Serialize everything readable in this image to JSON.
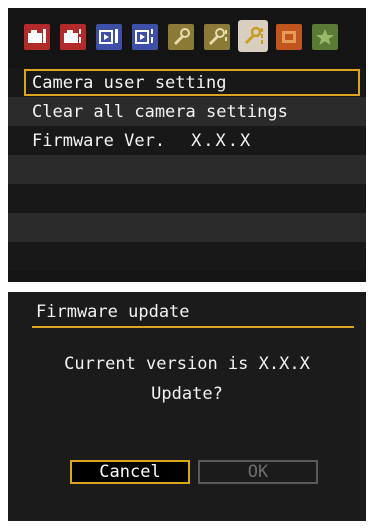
{
  "tabs": [
    {
      "name": "shooting-menu-1",
      "icon": "camera-icon",
      "color": "#b32a2a",
      "selected": false
    },
    {
      "name": "shooting-menu-2",
      "icon": "camera-dots-icon",
      "color": "#b32a2a",
      "selected": false
    },
    {
      "name": "playback-menu-1",
      "icon": "playback-icon",
      "color": "#3e4fa8",
      "selected": false
    },
    {
      "name": "playback-menu-2",
      "icon": "playback-dots-icon",
      "color": "#3e4fa8",
      "selected": false
    },
    {
      "name": "setup-menu-1",
      "icon": "wrench-icon",
      "color": "#8a7a35",
      "selected": false
    },
    {
      "name": "setup-menu-2",
      "icon": "wrench-dots-icon",
      "color": "#8a7a35",
      "selected": false
    },
    {
      "name": "setup-menu-3",
      "icon": "wrench-dots-icon",
      "color": "#c99b1e",
      "selected": true
    },
    {
      "name": "custom-functions",
      "icon": "custom-function-icon",
      "color": "#c0561e",
      "selected": false
    },
    {
      "name": "my-menu",
      "icon": "star-icon",
      "color": "#5b7a35",
      "selected": false
    }
  ],
  "menu": {
    "items": [
      {
        "label": "Camera user setting"
      },
      {
        "label": "Clear all camera settings"
      },
      {
        "label": "Firmware Ver.",
        "value": "X.X.X",
        "selected": true
      }
    ]
  },
  "dialog": {
    "title": "Firmware update",
    "message_line1": "Current version is X.X.X",
    "message_line2": "Update?",
    "cancel_label": "Cancel",
    "ok_label": "OK"
  },
  "colors": {
    "accent": "#d9a61e",
    "screen_bg": "#141414",
    "text": "#f4f4f4",
    "disabled_text": "#6e6e6e"
  }
}
